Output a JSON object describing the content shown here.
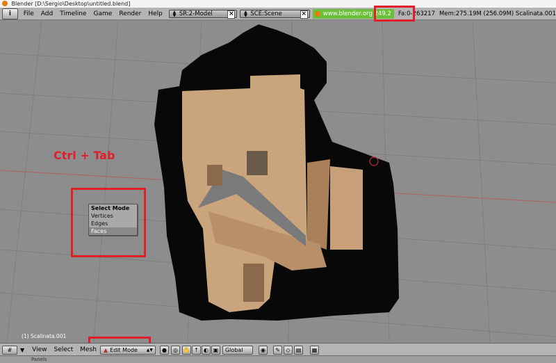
{
  "window": {
    "title": "Blender [D:\\Sergio\\Desktop\\untitled.blend]"
  },
  "menubar": {
    "items": [
      "File",
      "Add",
      "Timeline",
      "Game",
      "Render",
      "Help"
    ],
    "screen": "SR:2-Model",
    "scene": "SCE:Scene",
    "website": "www.blender.org 249.2",
    "faces": "Fa:0-263217",
    "memory": "Mem:275.19M (256.09M) Scalinata.001"
  },
  "overlay": {
    "shortcut": "Ctrl + Tab",
    "select_mode": {
      "title": "Select Mode",
      "options": [
        "Vertices",
        "Edges",
        "Faces"
      ],
      "selected": "Faces"
    }
  },
  "viewport": {
    "object_label": "(1) Scalinata.001"
  },
  "toolbar": {
    "menus": [
      "View",
      "Select",
      "Mesh"
    ],
    "mode": "Edit Mode",
    "orientation": "Global"
  },
  "bottom": {
    "panels_label": "Panels"
  },
  "colors": {
    "highlight_red": "#e01f2a",
    "web_green": "#6cbf3a",
    "blender_orange": "#e87d0d"
  },
  "icons": [
    "info-icon",
    "blender-logo-icon",
    "view3d-icon",
    "pivot-icon",
    "hand-icon",
    "snap-icon",
    "render-icon"
  ]
}
